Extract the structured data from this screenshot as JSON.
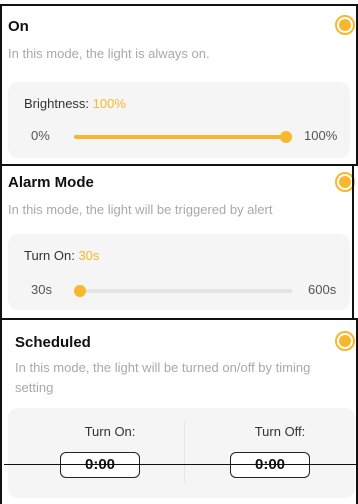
{
  "colors": {
    "accent": "#f8b72c",
    "panel": "#f5f5f5",
    "muted": "#a9a9a9"
  },
  "on_mode": {
    "title": "On",
    "description": "In this mode, the light is always on.",
    "selected": true,
    "brightness_label": "Brightness:",
    "brightness_value": "100%",
    "range_min": "0%",
    "range_max": "100%",
    "slider_level_percent": 100
  },
  "alarm_mode": {
    "title": "Alarm Mode",
    "description": "In this mode, the light will be triggered by alert",
    "selected": true,
    "turn_on_label": "Turn On:",
    "turn_on_value": "30s",
    "range_min": "30s",
    "range_max": "600s",
    "slider_level_percent": 0
  },
  "scheduled_mode": {
    "title": "Scheduled",
    "description": "In this mode, the light will be turned on/off by timing setting",
    "selected": true,
    "turn_on_label": "Turn On:",
    "turn_on_time": "0:00",
    "turn_off_label": "Turn Off:",
    "turn_off_time": "0:00"
  }
}
